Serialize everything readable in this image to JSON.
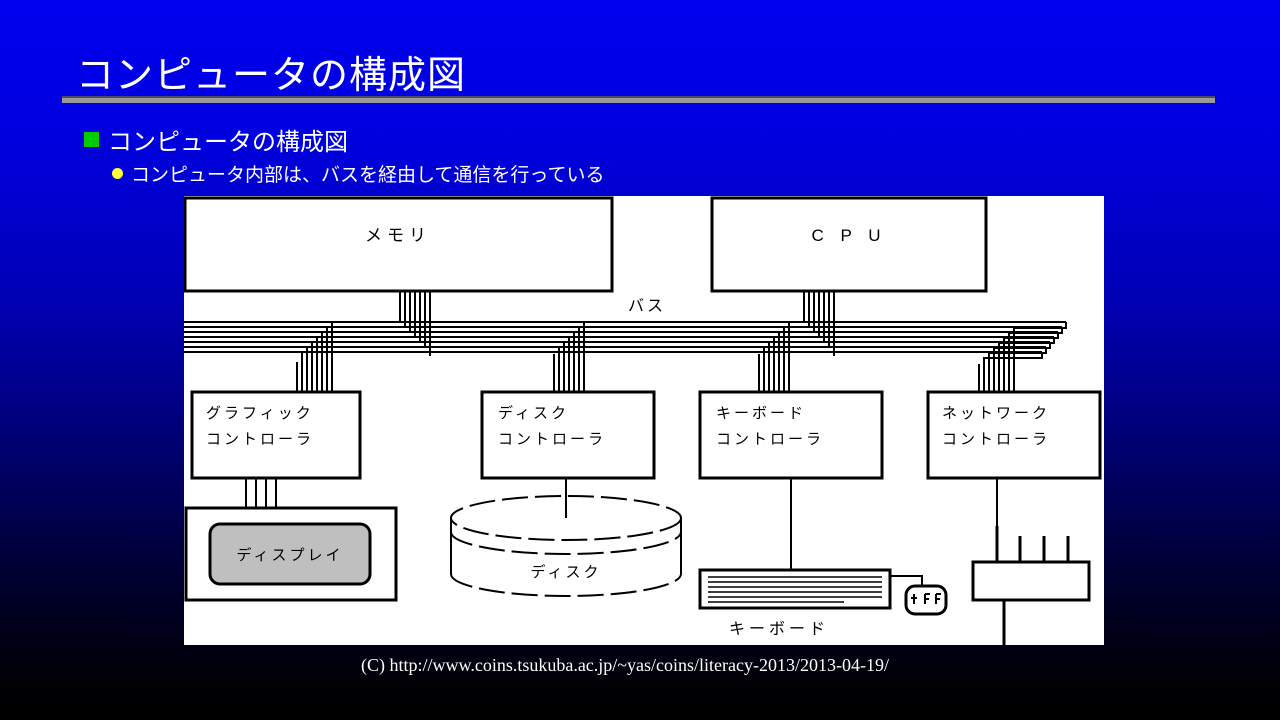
{
  "slide": {
    "title": "コンピュータの構成図",
    "bullets": [
      {
        "level": 1,
        "marker": "square",
        "marker_color": "#00cc00",
        "text": "コンピュータの構成図"
      },
      {
        "level": 2,
        "marker": "disc",
        "marker_color": "#ffff33",
        "text": "コンピュータ内部は、バスを経由して通信を行っている"
      }
    ],
    "footer": "(C) http://www.coins.tsukuba.ac.jp/~yas/coins/literacy-2013/2013-04-19/",
    "background_top_color": "#0000ee",
    "background_bottom_color": "#000000",
    "rule_color": "#9a9a9a"
  },
  "diagram": {
    "panel_background": "#ffffff",
    "line_color": "#000000",
    "bus_label": "バス",
    "top_units": [
      {
        "id": "memory",
        "label": "メモリ"
      },
      {
        "id": "cpu",
        "label": "C P U"
      }
    ],
    "controllers": [
      {
        "id": "graphic-controller",
        "line1": "グラフィック",
        "line2": "コントローラ"
      },
      {
        "id": "disk-controller",
        "line1": "ディスク",
        "line2": "コントローラ"
      },
      {
        "id": "keyboard-controller",
        "line1": "キーボード",
        "line2": "コントローラ"
      },
      {
        "id": "network-controller",
        "line1": "ネットワーク",
        "line2": "コントローラ"
      }
    ],
    "devices": [
      {
        "id": "display",
        "label": "ディスプレイ",
        "fill": "#bfbfbf"
      },
      {
        "id": "disk",
        "label": "ディスク",
        "shape": "cylinder"
      },
      {
        "id": "keyboard",
        "label": "キーボード",
        "shape": "keyboard"
      },
      {
        "id": "mouse",
        "label": "",
        "shape": "mouse"
      },
      {
        "id": "network-hub",
        "label": "",
        "shape": "hub"
      }
    ]
  }
}
